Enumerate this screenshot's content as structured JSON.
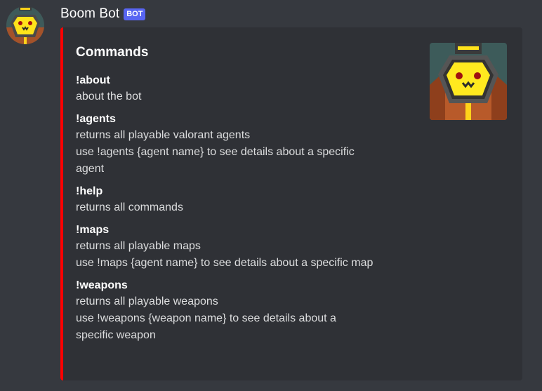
{
  "message": {
    "author": "Boom Bot",
    "badge": "BOT"
  },
  "embed": {
    "accent_color": "#ff0000",
    "title": "Commands",
    "fields": [
      {
        "name": "!about",
        "lines": [
          "about the bot"
        ]
      },
      {
        "name": "!agents",
        "lines": [
          "returns all playable valorant agents",
          "use !agents {agent name} to see details about a specific",
          "agent"
        ]
      },
      {
        "name": "!help",
        "lines": [
          "returns all commands"
        ]
      },
      {
        "name": "!maps",
        "lines": [
          "returns all playable maps",
          "use !maps {agent name} to see details about a specific map"
        ]
      },
      {
        "name": "!weapons",
        "lines": [
          "returns all playable weapons",
          "use !weapons {weapon name} to see details about a",
          "specific weapon"
        ]
      }
    ]
  },
  "icons": {
    "avatar": "robot-face-icon",
    "thumbnail": "robot-face-icon"
  }
}
